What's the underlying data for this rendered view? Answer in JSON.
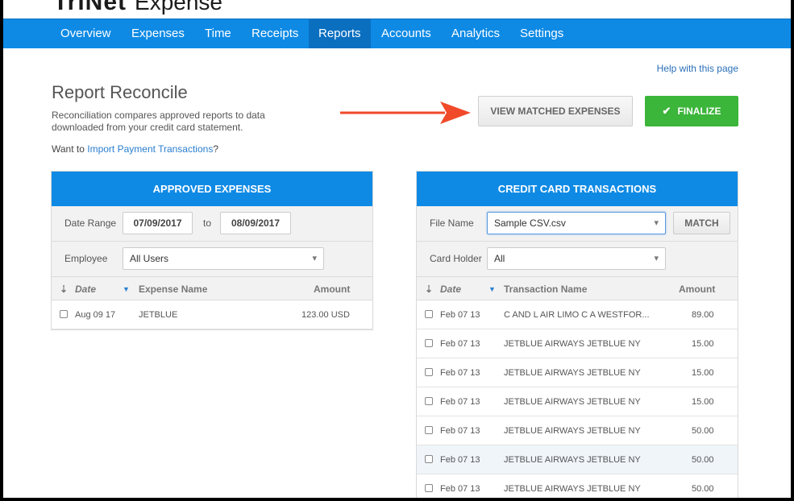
{
  "app": {
    "brand_main": "TriNet",
    "brand_product": "Expense"
  },
  "nav": {
    "items": [
      {
        "label": "Overview"
      },
      {
        "label": "Expenses"
      },
      {
        "label": "Time"
      },
      {
        "label": "Receipts"
      },
      {
        "label": "Reports"
      },
      {
        "label": "Accounts"
      },
      {
        "label": "Analytics"
      },
      {
        "label": "Settings"
      }
    ],
    "active": "Reports"
  },
  "help_link": "Help with this page",
  "page": {
    "title": "Report Reconcile",
    "description": "Reconciliation compares approved reports to data downloaded from your credit card statement.",
    "import_prefix": "Want to ",
    "import_link": "Import Payment Transactions",
    "import_suffix": "?"
  },
  "buttons": {
    "view_matched": "VIEW MATCHED EXPENSES",
    "finalize": "FINALIZE"
  },
  "approved": {
    "header": "APPROVED EXPENSES",
    "date_range_label": "Date Range",
    "date_from": "07/09/2017",
    "date_to_label": "to",
    "date_to": "08/09/2017",
    "employee_label": "Employee",
    "employee_value": "All Users",
    "columns": {
      "date": "Date",
      "name": "Expense Name",
      "amount": "Amount"
    },
    "rows": [
      {
        "date": "Aug 09 17",
        "name": "JETBLUE",
        "amount": "123.00 USD"
      }
    ]
  },
  "credit": {
    "header": "CREDIT CARD TRANSACTIONS",
    "file_label": "File Name",
    "file_value": "Sample CSV.csv",
    "match_label": "MATCH",
    "holder_label": "Card Holder",
    "holder_value": "All",
    "columns": {
      "date": "Date",
      "name": "Transaction Name",
      "amount": "Amount"
    },
    "rows": [
      {
        "date": "Feb 07 13",
        "name": "C AND L AIR LIMO C A WESTFOR...",
        "amount": "89.00"
      },
      {
        "date": "Feb 07 13",
        "name": "JETBLUE AIRWAYS JETBLUE NY",
        "amount": "15.00"
      },
      {
        "date": "Feb 07 13",
        "name": "JETBLUE AIRWAYS JETBLUE NY",
        "amount": "15.00"
      },
      {
        "date": "Feb 07 13",
        "name": "JETBLUE AIRWAYS JETBLUE NY",
        "amount": "15.00"
      },
      {
        "date": "Feb 07 13",
        "name": "JETBLUE AIRWAYS JETBLUE NY",
        "amount": "50.00"
      },
      {
        "date": "Feb 07 13",
        "name": "JETBLUE AIRWAYS JETBLUE NY",
        "amount": "50.00"
      },
      {
        "date": "Feb 07 13",
        "name": "JETBLUE AIRWAYS JETBLUE NY",
        "amount": "50.00"
      }
    ]
  },
  "colors": {
    "brand_blue": "#0e8ae5",
    "nav_active": "#0b6fc0",
    "finalize_green": "#3bb53a",
    "arrow_red": "#f04a2a",
    "row_highlight": "#f0f5fa"
  }
}
